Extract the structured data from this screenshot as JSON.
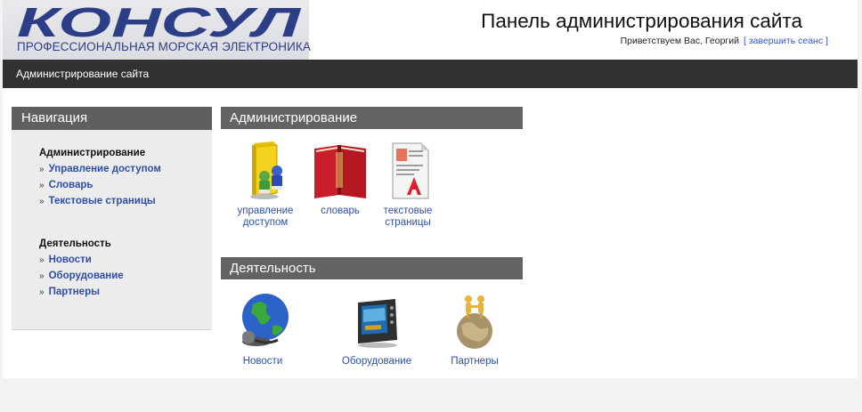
{
  "header": {
    "logo_text": "КОНСУЛ",
    "logo_subtitle": "ПРОФЕССИОНАЛЬНАЯ МОРСКАЯ ЭЛЕКТРОНИКА",
    "title": "Панель администрирования сайта",
    "greeting": "Приветствуем Вас, Георгий",
    "logout_label": "[ завершить сеанс ]"
  },
  "topbar": {
    "label": "Администрирование сайта"
  },
  "nav": {
    "title": "Навигация",
    "groups": [
      {
        "title": "Администрирование",
        "items": [
          {
            "label": "Управление доступом"
          },
          {
            "label": "Словарь"
          },
          {
            "label": "Текстовые страницы"
          }
        ]
      },
      {
        "title": "Деятельность",
        "items": [
          {
            "label": "Новости"
          },
          {
            "label": "Оборудование"
          },
          {
            "label": "Партнеры"
          }
        ]
      }
    ],
    "bullet": "»"
  },
  "sections": [
    {
      "title": "Администрирование",
      "tiles": [
        {
          "label_line1": "управление",
          "label_line2": "доступом",
          "icon": "folder-users-icon"
        },
        {
          "label_line1": "словарь",
          "label_line2": "",
          "icon": "dictionary-book-icon"
        },
        {
          "label_line1": "текстовые",
          "label_line2": "страницы",
          "icon": "text-document-icon"
        }
      ]
    },
    {
      "title": "Деятельность",
      "tiles": [
        {
          "label_line1": "Новости",
          "label_line2": "",
          "icon": "globe-microphone-icon"
        },
        {
          "label_line1": "Оборудование",
          "label_line2": "",
          "icon": "navigation-device-icon"
        },
        {
          "label_line1": "Партнеры",
          "label_line2": "",
          "icon": "partners-globe-icon"
        }
      ]
    }
  ],
  "colors": {
    "link": "#2f4ea8",
    "section_header": "#636363",
    "topbar": "#313131",
    "logo_blue": "#2c3f86"
  }
}
